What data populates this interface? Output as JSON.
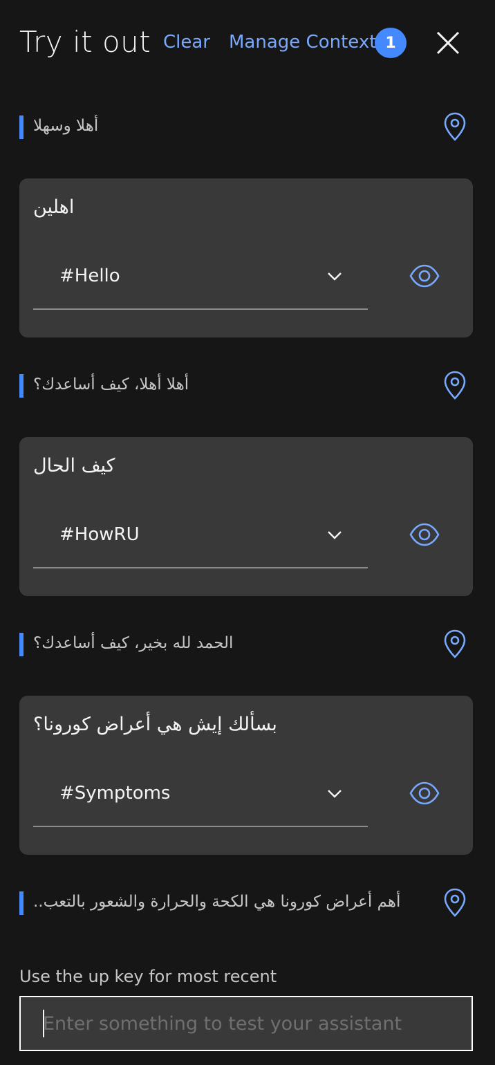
{
  "header": {
    "title": "Try it out",
    "clear_label": "Clear",
    "manage_context_label": "Manage Context",
    "context_count": "1",
    "close_icon": "close-icon"
  },
  "conversation": {
    "bot_messages": [
      "أهلا وسهلا",
      "أهلا أهلا، كيف أساعدك؟",
      "الحمد لله بخير، كيف أساعدك؟",
      "أهم أعراض كورونا هي الكحة والحرارة والشعور بالتعب.."
    ],
    "user_turns": [
      {
        "utterance": "اهلين",
        "intent": "#Hello"
      },
      {
        "utterance": "كيف الحال",
        "intent": "#HowRU"
      },
      {
        "utterance": "بسألك إيش هي أعراض كورونا؟",
        "intent": "#Symptoms"
      }
    ]
  },
  "input": {
    "hint": "Use the up key for most recent",
    "placeholder": "Enter something to test your assistant",
    "value": ""
  },
  "colors": {
    "background": "#161616",
    "card": "#393939",
    "accent": "#4589ff",
    "link": "#78a9ff"
  }
}
